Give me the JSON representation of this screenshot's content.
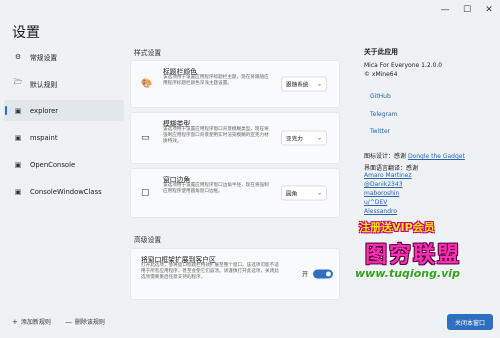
{
  "window": {
    "minimize": "—",
    "maximize": "☐",
    "close": "✕"
  },
  "title": "设置",
  "sidebar": {
    "items": [
      {
        "icon": "⚙",
        "label": "常规设置"
      },
      {
        "icon": "🗁",
        "label": "默认规则"
      },
      {
        "icon": "▣",
        "label": "explorer"
      },
      {
        "icon": "▣",
        "label": "mspaint"
      },
      {
        "icon": "▣",
        "label": "OpenConsole"
      },
      {
        "icon": "▣",
        "label": "ConsoleWindowClass"
      }
    ],
    "add_label": "添加新规则",
    "delete_label": "删除该规则"
  },
  "main": {
    "style_section": "样式设置",
    "advanced_section": "高级设置",
    "cards": [
      {
        "icon": "🎨",
        "title": "标题栏颜色",
        "desc": "该选项用于设置应用程序标题栏主题，现在将跟随应用程序标题栏颜色深浅主题设置。",
        "value": "跟随系统"
      },
      {
        "icon": "▭",
        "title": "模糊类型",
        "desc": "该选项用于设置应用程序窗口背景模糊类型，现在将强制应用程序窗口背景使用实时渲染模糊的亚克力材质特效。",
        "value": "亚克力"
      },
      {
        "icon": "▢",
        "title": "窗口边角",
        "desc": "该选项用于设置应用程序窗口边角半径，现在将强制应用程序使用圆角窗口边框。",
        "value": "圆角"
      }
    ],
    "extend": {
      "title": "将窗口框架扩展到客户区",
      "desc": "打开此选项，会将窗口标题栏特效扩展至整个窗口。该选项可能不适用于所有应用程序，甚至会使它们崩溃。请谨慎打开此选项，关闭此选项需要重启任意支持的程序。",
      "toggle_label": "开",
      "on": true
    }
  },
  "about": {
    "head": "关于此应用",
    "version": "Mica For Everyone 1.2.0.0",
    "author": "© xMine64",
    "links": [
      "GitHub",
      "Telegram",
      "Twitter"
    ],
    "icon_design_prefix": "图标设计：感谢",
    "icon_design_link": "Dongle the Gadget",
    "translation": "界面语言翻译：感谢",
    "translators": [
      "Amaro Martinez",
      "@Danik2343",
      "maboroshin",
      "u/^DEV",
      "Alessandro"
    ],
    "close_button": "关闭本窗口"
  },
  "watermark": {
    "line1": "注册送VIP会员",
    "line2": "图穷联盟",
    "line3": "www.tuqiong.vip"
  },
  "colors": {
    "accent": "#2f6fbf",
    "background": "#eef2f5",
    "card": "#f9fafb"
  }
}
